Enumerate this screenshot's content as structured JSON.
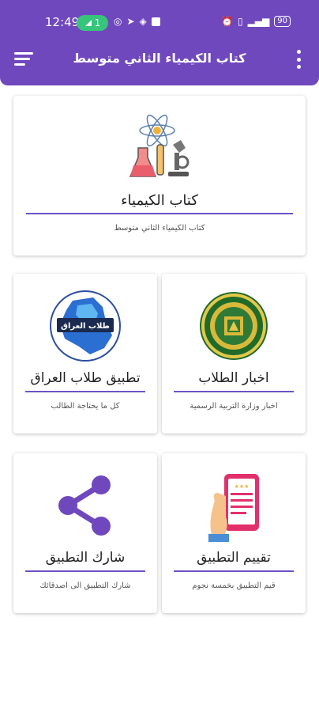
{
  "status_bar": {
    "time": "12:49",
    "notification_count": "1",
    "battery": "90"
  },
  "app_bar": {
    "title": "كتاب الكيمياء الثاني متوسط",
    "menu_icon": "hamburger-menu-icon",
    "overflow_icon": "more-vert-icon",
    "background": "#7048bd"
  },
  "cards": {
    "chemistry": {
      "title": "كتاب الكيمياء",
      "subtitle": "كتاب الكيمياء الثاني متوسط",
      "icon": "chemistry-lab-icon"
    },
    "news": {
      "title": "اخبار الطلاب",
      "subtitle": "اخبار وزارة التربية الرسمية",
      "icon": "ministry-seal-icon"
    },
    "iraq_app": {
      "title": "تطبيق طلاب العراق",
      "subtitle": "كل ما يحتاجة الطالب",
      "icon": "iraq-map-logo-icon",
      "logo_text": "طلاب العراق"
    },
    "rate": {
      "title": "تقييم التطبيق",
      "subtitle": "قيم التطبيق بخمسة نجوم",
      "icon": "rating-phone-icon"
    },
    "share": {
      "title": "شارك التطبيق",
      "subtitle": "شارك التطبيق الى اصدقائك",
      "icon": "share-icon"
    }
  },
  "accent_color": "#6e52c7"
}
